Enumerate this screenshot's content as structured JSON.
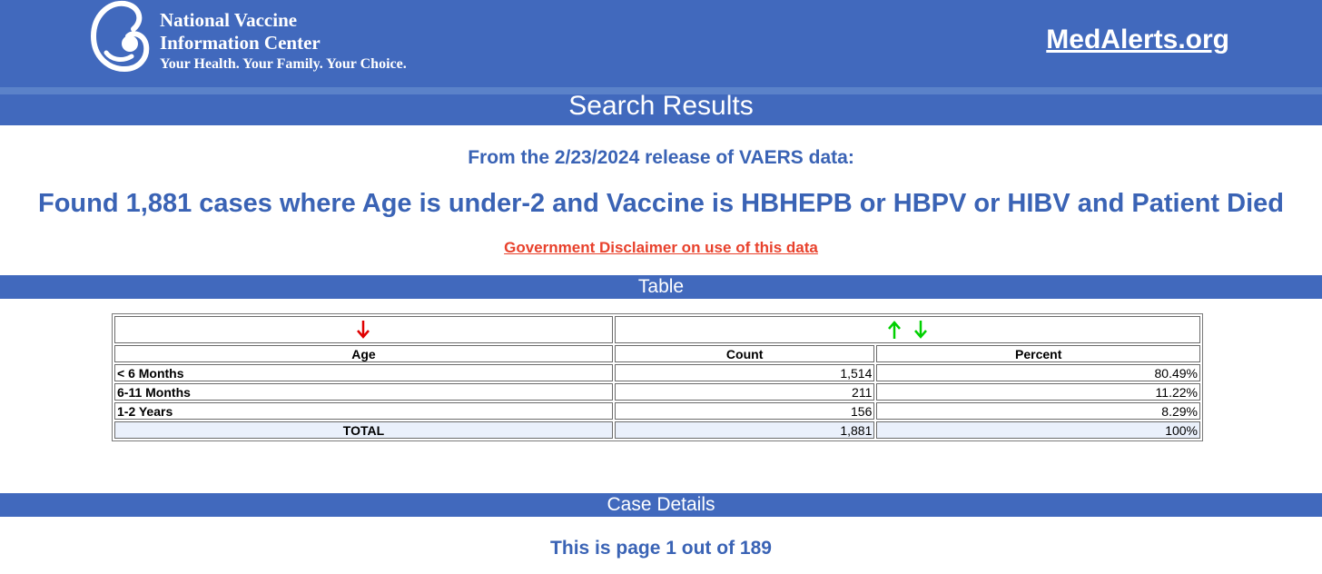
{
  "header": {
    "org_line1": "National Vaccine",
    "org_line2": "Information Center",
    "tagline": "Your Health. Your Family. Your Choice.",
    "site_link": "MedAlerts.org",
    "logo_icon": "nvic-mother-child-logo"
  },
  "search_title": "Search Results",
  "release_text": "From the 2/23/2024 release of VAERS data:",
  "found_text": "Found 1,881 cases where Age is under-2 and Vaccine is HBHEPB or HBPV or HIBV and Patient Died",
  "disclaimer_link": "Government Disclaimer on use of this data",
  "table_section_title": "Table",
  "table": {
    "sort_icons": {
      "age": "red-down-arrow-icon",
      "count_up": "green-up-arrow-icon",
      "count_down": "green-down-arrow-icon"
    },
    "columns": [
      "Age",
      "Count",
      "Percent"
    ],
    "rows": [
      {
        "age": "< 6 Months",
        "count": "1,514",
        "percent": "80.49%"
      },
      {
        "age": "6-11 Months",
        "count": "211",
        "percent": "11.22%"
      },
      {
        "age": "1-2 Years",
        "count": "156",
        "percent": "8.29%"
      }
    ],
    "total": {
      "label": "TOTAL",
      "count": "1,881",
      "percent": "100%"
    }
  },
  "case_details_title": "Case Details",
  "pager_text": "This is page 1 out of 189",
  "colors": {
    "header_blue": "#4169bd",
    "heading_text_blue": "#3a63b5",
    "disclaimer_red": "#e8412c",
    "sort_red": "#e00000",
    "sort_green": "#00d000",
    "total_row_bg": "#eaf0fb"
  }
}
